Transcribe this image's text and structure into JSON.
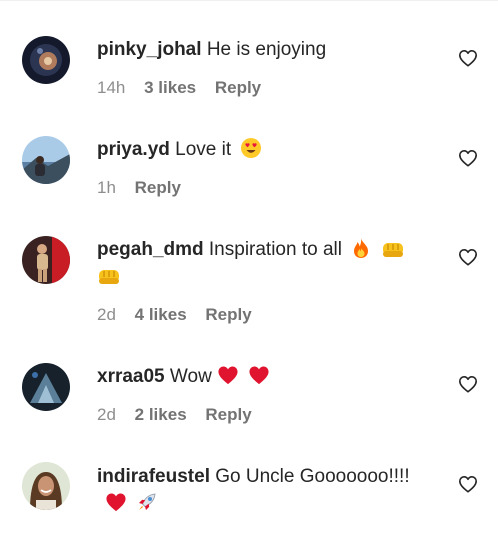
{
  "comments": [
    {
      "username": "pinky_johal",
      "text": "He is enjoying",
      "time": "14h",
      "likes": "3 likes",
      "reply": "Reply"
    },
    {
      "username": "priya.yd",
      "text": "Love it",
      "emoji": [
        "heart-eyes-emoji"
      ],
      "time": "1h",
      "reply": "Reply"
    },
    {
      "username": "pegah_dmd",
      "text": "Inspiration to all",
      "emoji": [
        "fire-emoji",
        "fist-emoji",
        "fist-emoji"
      ],
      "time": "2d",
      "likes": "4 likes",
      "reply": "Reply"
    },
    {
      "username": "xrraa05",
      "text": "Wow",
      "emoji": [
        "red-heart-emoji",
        "red-heart-emoji"
      ],
      "time": "2d",
      "likes": "2 likes",
      "reply": "Reply"
    },
    {
      "username": "indirafeustel",
      "text": "Go Uncle Gooooooo!!!!",
      "emoji": [
        "red-heart-emoji",
        "rocket-emoji"
      ]
    }
  ],
  "icons": {
    "like": "heart-outline-icon"
  },
  "colors": {
    "text": "#262626",
    "meta": "#8e8e8e",
    "heart_emoji": "#e0142f",
    "fire_emoji": "#ff6a00",
    "fist_emoji": "#f7c21b"
  }
}
